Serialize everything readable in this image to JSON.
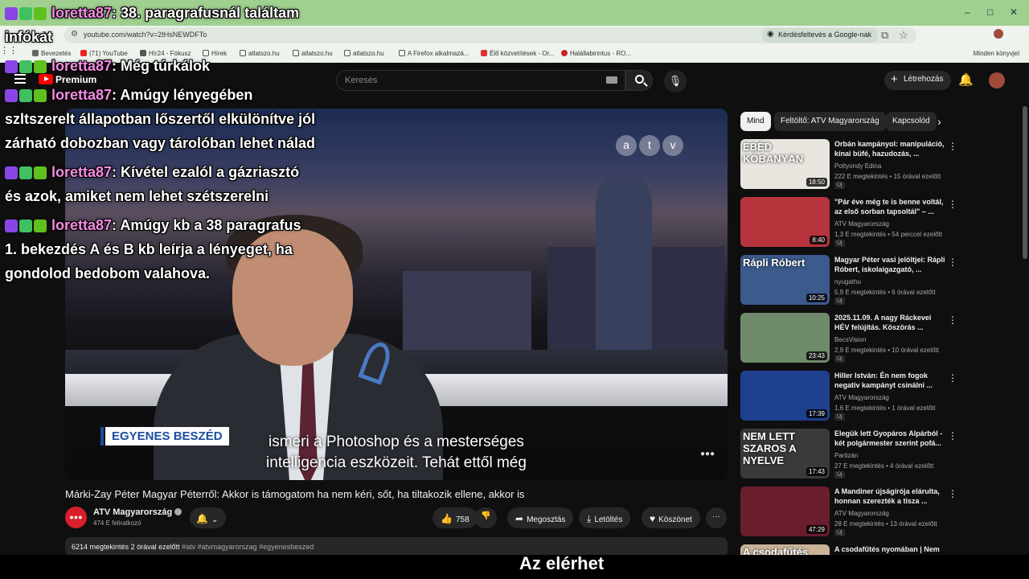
{
  "browser": {
    "url": "youtube.com/watch?v=2tHsNEWDFTo",
    "google_search_label": "Kérdésfeltevés a Google-nak",
    "bookmarks": [
      "Bevezetés",
      "(71) YouTube",
      "Hír24 - Fókusz",
      "Hírek",
      "atlatszo.hu",
      "atlatszo.hu",
      "atlatszo.hu",
      "A Firefox alkalmazá...",
      "Élő közvetítések - Or...",
      "Halállabirintus - RO..."
    ],
    "bookmarks_right": "Minden könyvjel",
    "tab_controls": [
      "–",
      "□",
      "✕"
    ]
  },
  "youtube": {
    "logo_label": "Premium",
    "logo_country": "HU",
    "search_placeholder": "Keresés",
    "create_label": "Létrehozás"
  },
  "player": {
    "channel_logo_letters": [
      "a",
      "t",
      "v"
    ],
    "lower_third": "EGYENES BESZÉD",
    "captions_line1": "ismeri a Photoshop és a mesterséges",
    "captions_line2": "intelligencia eszközeit. Tehát ettől még",
    "controls_glyph": "●●●"
  },
  "video": {
    "title": "Márki-Zay Péter Magyar Péterről: Akkor is támogatom ha nem kéri, sőt, ha tiltakozik ellene, akkor is",
    "channel": "ATV Magyarország",
    "channel_avatar_text": "●●●",
    "subscribers": "474 E feliratkozó",
    "likes": "758",
    "share_label": "Megosztás",
    "download_label": "Letöltés",
    "thanks_label": "Köszönet",
    "more_label": "···",
    "views": "6214 megtekintés",
    "age": "2 órával ezelőtt",
    "tags": "#atv #atvmagyarorszag #egyenesbeszed"
  },
  "chips": [
    "Mind",
    "Feltöltő: ATV Magyarország",
    "Kapcsolód"
  ],
  "recommendations": [
    {
      "title": "Orbán kampányol: manipuláció, kínai büfé, hazudozás, ...",
      "channel": "Pottyondy Edina",
      "meta": "222 E megtekintés • 15 órával ezelőtt",
      "duration": "18:50",
      "badge": "Új",
      "thumb_color": "#e9e5df",
      "thumb_text": "EBÉD KÓBANYÁN"
    },
    {
      "title": "\"Pár éve még te is benne voltál, az első sorban tapsoltál\" – ...",
      "channel": "ATV Magyarország",
      "meta": "1,3 E megtekintés • 54 perccel ezelőtt",
      "duration": "8:40",
      "badge": "Új",
      "thumb_color": "#b8343c",
      "thumb_text": ""
    },
    {
      "title": "Magyar Péter vasi jelöltjei: Rápli Róbert, iskolaigazgató, ...",
      "channel": "nyugathu",
      "meta": "5,9 E megtekintés • 6 órával ezelőtt",
      "duration": "10:25",
      "badge": "Új",
      "thumb_color": "#3c5a8c",
      "thumb_text": "Rápli Róbert"
    },
    {
      "title": "2025.11.09. A nagy Ráckevei HÉV felújítás. Köszörás ...",
      "channel": "BecsVision",
      "meta": "2,9 E megtekintés • 10 órával ezelőtt",
      "duration": "23:43",
      "badge": "Új",
      "thumb_color": "#6f8a6a",
      "thumb_text": ""
    },
    {
      "title": "Hiller István: Én nem fogok negatív kampányt csinálni ...",
      "channel": "ATV Magyarország",
      "meta": "1,6 E megtekintés • 1 órával ezelőtt",
      "duration": "17:39",
      "badge": "Új",
      "thumb_color": "#1f3f8f",
      "thumb_text": ""
    },
    {
      "title": "Elegük lett Gyopáros Alpárból - két polgármester szerint pofá...",
      "channel": "Partizán",
      "meta": "27 E megtekintés • 4 órával ezelőtt",
      "duration": "17:43",
      "badge": "Új",
      "thumb_color": "#3a3a3a",
      "thumb_text": "NEM LETT SZAROS A NYELVE"
    },
    {
      "title": "A Mandiner újságírója elárulta, honnan szerezték a tisza ...",
      "channel": "ATV Magyarország",
      "meta": "28 E megtekintés • 13 órával ezelőtt",
      "duration": "47:29",
      "badge": "Új",
      "thumb_color": "#6a1d2c",
      "thumb_text": ""
    },
    {
      "title": "A csodafűtés nyomában | Nem",
      "channel": "",
      "meta": "",
      "duration": "",
      "badge": "",
      "thumb_color": "#c9b49a",
      "thumb_text": "A csodafűtés"
    }
  ],
  "chat": [
    {
      "user": "loretta87",
      "text": ": 38. paragrafusnál találtam"
    },
    {
      "user": "",
      "text": "infókat"
    },
    {
      "user": "loretta87",
      "text": ": Még túrkálok"
    },
    {
      "user": "loretta87",
      "text": ": Amúgy lényegében"
    },
    {
      "user": "",
      "text": "szltszerelt állapotban lőszertől elkülönítve jól"
    },
    {
      "user": "",
      "text": "zárható dobozban vagy tárolóban lehet nálad"
    },
    {
      "user": "loretta87",
      "text": ": Kívétel ezalól a gázriasztó"
    },
    {
      "user": "",
      "text": "és azok, amiket nem lehet szétszerelni"
    },
    {
      "user": "loretta87",
      "text": ": Amúgy kb a 38 paragrafus"
    },
    {
      "user": "",
      "text": "1. bekezdés A és B kb leírja a lényeget, ha"
    },
    {
      "user": "",
      "text": "gondolod bedobom valahova."
    }
  ],
  "bottom_text": "Az elérhet"
}
